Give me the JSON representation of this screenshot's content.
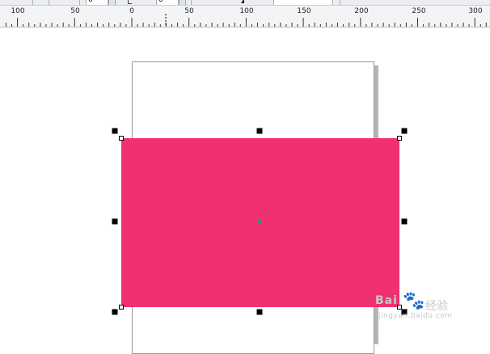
{
  "toolbar": {
    "field_1_value": "0",
    "field_2_value": "0"
  },
  "ruler": {
    "labels": [
      "100",
      "50",
      "0",
      "50",
      "100",
      "150",
      "200",
      "250",
      "300"
    ]
  },
  "watermark": {
    "brand": "Bai",
    "brand_cn": "经验",
    "url": "jingyan.baidu.com"
  },
  "colors": {
    "shape_fill": "#f03070",
    "center_marker": "#2f9a76",
    "ruler_bg": "#f3f4f6"
  },
  "icons": {
    "center": "x-marker-icon",
    "watermark": "paw-icon"
  }
}
